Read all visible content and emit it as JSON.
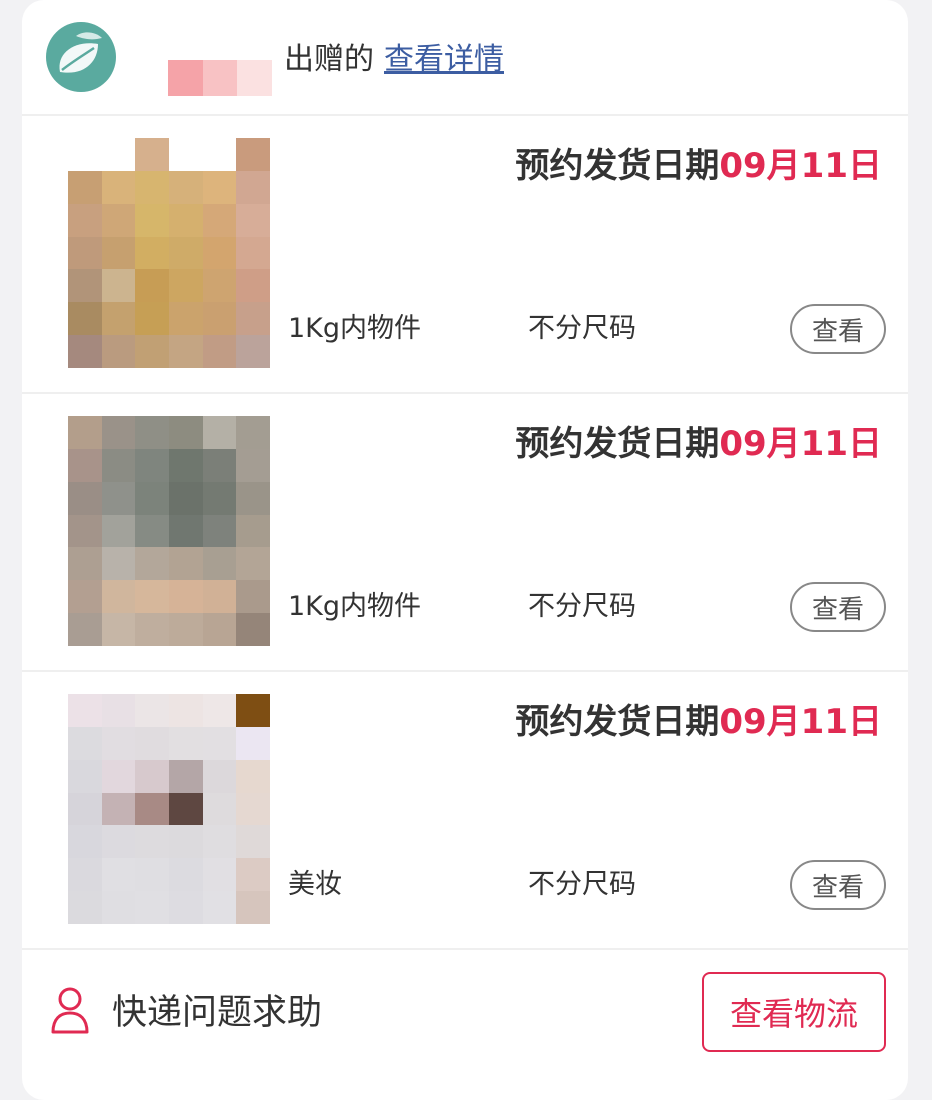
{
  "header": {
    "gift_text": "出赠的",
    "detail_link": "查看详情",
    "censor_colors": [
      "#f5a3a8",
      "#f8c2c4",
      "#fbe1e1"
    ]
  },
  "items": [
    {
      "date_prefix": "预约发货日期",
      "date_value": "09月11日",
      "category": "1Kg内物件",
      "size": "不分尺码",
      "view_label": "查看",
      "pixels": [
        "#ffffff",
        "#ffffff",
        "#d6b08d",
        "#ffffff",
        "#ffffff",
        "#c99b7d",
        "#c79f73",
        "#d9b37a",
        "#d7b56f",
        "#d6b17a",
        "#ddb47c",
        "#d1a792",
        "#c8a07f",
        "#cfa777",
        "#d6b66a",
        "#d5b06e",
        "#d5a878",
        "#d7ad98",
        "#bf9a7b",
        "#c6a06f",
        "#d2ae62",
        "#cfab68",
        "#d3a56e",
        "#d4a891",
        "#b19479",
        "#ccb48f",
        "#c79d55",
        "#cda661",
        "#cea470",
        "#cf9e87",
        "#a98b61",
        "#c4a16e",
        "#c69f55",
        "#cba36c",
        "#caa070",
        "#c7a08b",
        "#a5897e",
        "#ba9b7f",
        "#c1a074",
        "#c4a583",
        "#c19c85",
        "#bba39b"
      ]
    },
    {
      "date_prefix": "预约发货日期",
      "date_value": "09月11日",
      "category": "1Kg内物件",
      "size": "不分尺码",
      "view_label": "查看",
      "pixels": [
        "#b39e8b",
        "#9a9289",
        "#8f8f86",
        "#8d8c80",
        "#b4b0a6",
        "#a39d92",
        "#a8938a",
        "#8b8c84",
        "#7f857e",
        "#6f776e",
        "#7b7f78",
        "#a49d93",
        "#9a8e86",
        "#8f918b",
        "#7c837b",
        "#6b726a",
        "#747a72",
        "#9a9489",
        "#a3948a",
        "#a2a29b",
        "#868b84",
        "#707770",
        "#7e827c",
        "#a69c8e",
        "#ad9f92",
        "#b8b2aa",
        "#b3a79a",
        "#b2a393",
        "#a89f92",
        "#b3a596",
        "#b39f91",
        "#d0b69d",
        "#d6b79b",
        "#d6b397",
        "#d1b196",
        "#aa9a8c",
        "#a99d93",
        "#c6b6a6",
        "#bfae9e",
        "#bdab9a",
        "#b8a594",
        "#958579"
      ]
    },
    {
      "date_prefix": "预约发货日期",
      "date_value": "09月11日",
      "category": "美妆",
      "size": "不分尺码",
      "view_label": "查看",
      "pixels": [
        "#ece1e7",
        "#e8e0e5",
        "#ebe5e6",
        "#ede4e3",
        "#eee7e7",
        "#7e4e13",
        "#dcdbdf",
        "#e1dde1",
        "#e0dcdf",
        "#e2dfe1",
        "#e2dfe2",
        "#ebe6f2",
        "#d9d8dd",
        "#e2d7dd",
        "#d7c9cd",
        "#b4a6a7",
        "#dcd8db",
        "#e6d8cf",
        "#d6d4da",
        "#c4b2b4",
        "#a88a85",
        "#5e4741",
        "#dedbdd",
        "#e5d8d1",
        "#d8d7dd",
        "#dcdadf",
        "#dddbde",
        "#dcdadd",
        "#dfdde0",
        "#dfd9d8",
        "#dad9de",
        "#e0dfe3",
        "#dfdee2",
        "#dcdbe0",
        "#e1dfe3",
        "#dccbc4",
        "#dbdade",
        "#dfdee2",
        "#e0dfe3",
        "#dddce1",
        "#e1e0e4",
        "#d6c5bd"
      ]
    }
  ],
  "footer": {
    "help_label": "快递问题求助",
    "logistics_label": "查看物流"
  },
  "colors": {
    "accent": "#e02a52",
    "link": "#3c5da2",
    "logo": "#5aaa9f"
  }
}
